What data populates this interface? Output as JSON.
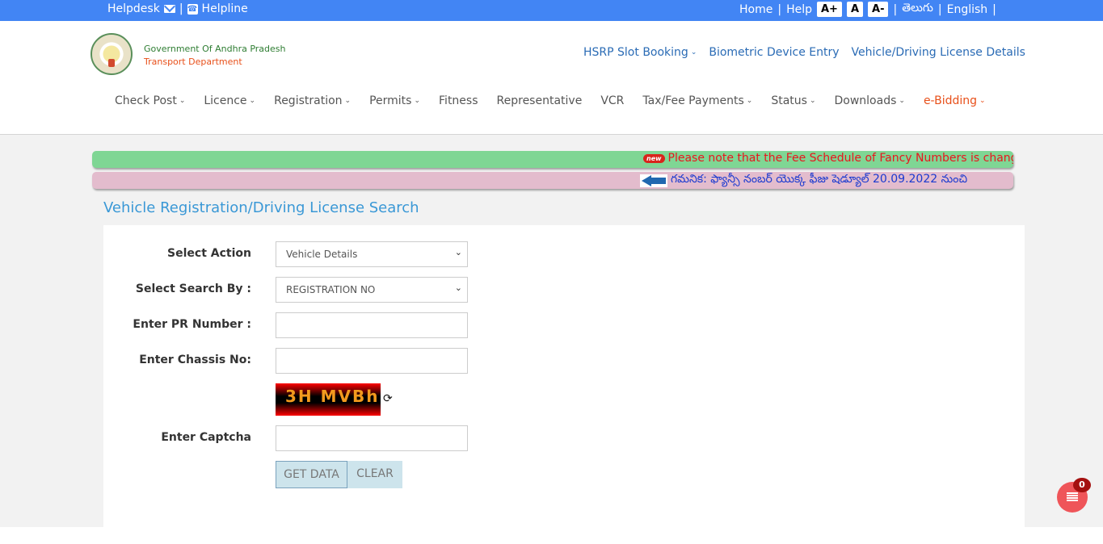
{
  "topbar": {
    "helpdesk": "Helpdesk",
    "helpline": "Helpline",
    "separator": "|",
    "home": "Home",
    "help": "Help",
    "font_increase": "A+",
    "font_normal": "A",
    "font_decrease": "A-",
    "lang_telugu": "తెలుగు",
    "lang_english": "English"
  },
  "header": {
    "org_name": "Government Of Andhra Pradesh",
    "dept_name": "Transport Department",
    "top_links": [
      {
        "label": "HSRP Slot Booking",
        "dropdown": true
      },
      {
        "label": "Biometric Device Entry",
        "dropdown": false
      },
      {
        "label": "Vehicle/Driving License Details",
        "dropdown": false
      }
    ],
    "nav": [
      {
        "label": "Check Post",
        "dropdown": true
      },
      {
        "label": "Licence",
        "dropdown": true
      },
      {
        "label": "Registration",
        "dropdown": true
      },
      {
        "label": "Permits",
        "dropdown": true
      },
      {
        "label": "Fitness",
        "dropdown": false
      },
      {
        "label": "Representative",
        "dropdown": false
      },
      {
        "label": "VCR",
        "dropdown": false
      },
      {
        "label": "Tax/Fee Payments",
        "dropdown": true
      },
      {
        "label": "Status",
        "dropdown": true
      },
      {
        "label": "Downloads",
        "dropdown": true
      },
      {
        "label": "e-Bidding",
        "dropdown": true
      }
    ],
    "accent_color": "#e8501a"
  },
  "notices": {
    "new_badge": "new",
    "english": "Please note that the Fee Schedule of Fancy Numbers is changed",
    "telugu": "గమనిక: ఫ్యాన్సీ నంబర్ యొక్క ఫీజు షెడ్యూల్ 20.09.2022 నుంచి"
  },
  "form": {
    "title": "Vehicle Registration/Driving License Search",
    "select_action_label": "Select Action",
    "select_action_value": "Vehicle Details",
    "search_by_label": "Select Search By :",
    "search_by_value": "REGISTRATION NO",
    "pr_number_label": "Enter PR Number :",
    "pr_number_value": "",
    "chassis_label": "Enter Chassis No:",
    "chassis_value": "",
    "captcha_text": "3H MVBh",
    "captcha_label": "Enter Captcha",
    "captcha_value": "",
    "get_data_button": "GET DATA",
    "clear_button": "CLEAR"
  },
  "fab": {
    "count": "0"
  }
}
